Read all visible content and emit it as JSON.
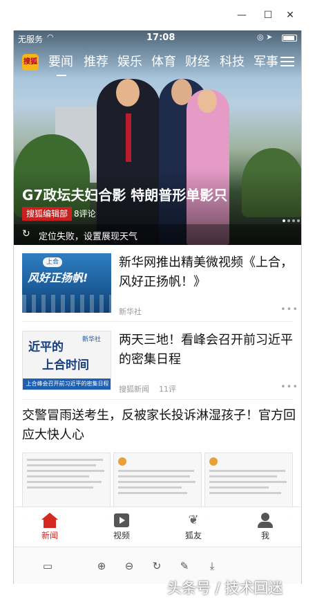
{
  "window": {
    "minimize_icon": "minimize-icon",
    "maximize_icon": "maximize-icon",
    "close_icon": "close-icon"
  },
  "status_bar": {
    "carrier": "无服务",
    "time": "17:08"
  },
  "top_tabs": {
    "logo": "搜狐",
    "items": [
      "要闻",
      "推荐",
      "娱乐",
      "体育",
      "财经",
      "科技",
      "军事"
    ],
    "active": "要闻"
  },
  "hero": {
    "title": "G7政坛夫妇合影 特朗普形单影只",
    "source": "搜狐编辑部",
    "comments": "8评论",
    "weather_text": "定位失败，设置展现天气"
  },
  "articles": [
    {
      "title": "新华网推出精美微视频《上合，风好正扬帆！》",
      "source": "新华社",
      "comments": "",
      "thumb_caption": "风好正扬帆!",
      "thumb_tag": "上合"
    },
    {
      "title": "两天三地！看峰会召开前习近平的密集日程",
      "source": "搜狐新闻",
      "comments": "11评",
      "thumb_line1": "近平的",
      "thumb_line2": "上合时间",
      "thumb_brand": "新华社",
      "thumb_band": "上合峰会召开前习近平的密集日程"
    },
    {
      "title": "交警冒雨送考生，反被家长投诉淋湿孩子！官方回应大快人心"
    }
  ],
  "bottom_nav": [
    {
      "label": "新闻",
      "icon": "home-icon",
      "active": true
    },
    {
      "label": "视频",
      "icon": "video-play-icon",
      "active": false
    },
    {
      "label": "狐友",
      "icon": "fox-friend-icon",
      "active": false
    },
    {
      "label": "我",
      "icon": "user-icon",
      "active": false
    }
  ],
  "viewer_toolbar": {
    "icons": [
      "fit-screen-icon",
      "zoom-in-icon",
      "zoom-out-icon",
      "rotate-icon",
      "edit-icon",
      "download-icon"
    ]
  },
  "watermark": "头条号 / 技术回迷",
  "colors": {
    "accent_red": "#d2281f",
    "source_tag_red": "#c7211f"
  }
}
